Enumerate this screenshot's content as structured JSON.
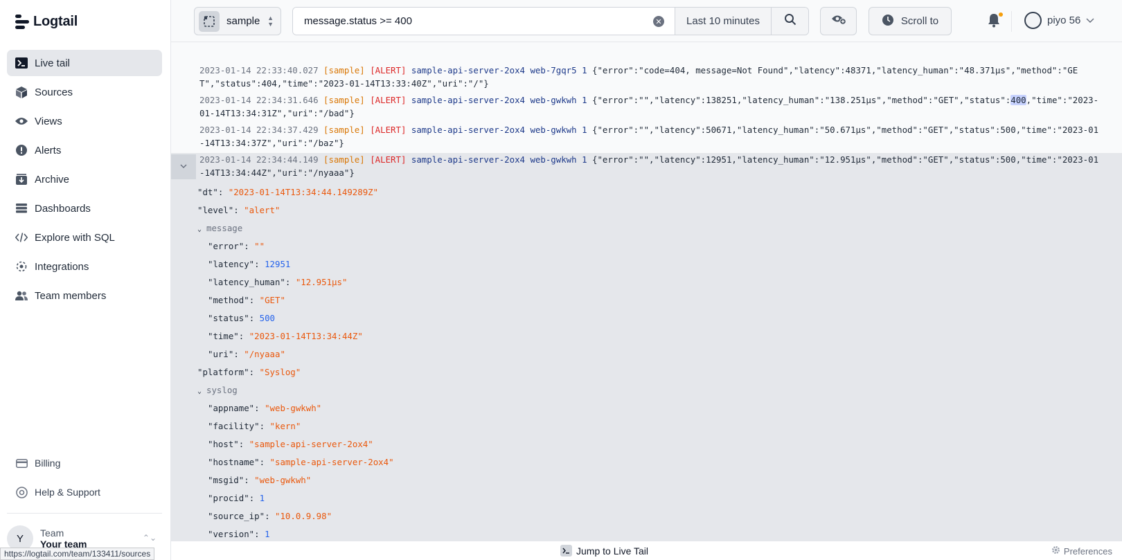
{
  "app": {
    "name": "Logtail"
  },
  "sidebar": {
    "items": [
      {
        "label": "Live tail",
        "icon": "terminal-icon"
      },
      {
        "label": "Sources",
        "icon": "cube-icon"
      },
      {
        "label": "Views",
        "icon": "eye-icon"
      },
      {
        "label": "Alerts",
        "icon": "alert-icon"
      },
      {
        "label": "Archive",
        "icon": "archive-icon"
      },
      {
        "label": "Dashboards",
        "icon": "dashboard-icon"
      },
      {
        "label": "Explore with SQL",
        "icon": "code-icon"
      },
      {
        "label": "Integrations",
        "icon": "integrations-icon"
      },
      {
        "label": "Team members",
        "icon": "users-icon"
      }
    ],
    "bottom": [
      {
        "label": "Billing",
        "icon": "card-icon"
      },
      {
        "label": "Help & Support",
        "icon": "help-icon"
      }
    ],
    "team": {
      "avatar": "Y",
      "label": "Team",
      "name": "Your team"
    },
    "status_url": "https://logtail.com/team/133411/sources"
  },
  "topbar": {
    "source": "sample",
    "query": "message.status >= 400",
    "time_range": "Last 10 minutes",
    "scroll_to": "Scroll to",
    "user": "piyo 56"
  },
  "logs": [
    {
      "ts": "2023-01-14 22:33:40.027",
      "source": "[sample]",
      "level": "[ALERT]",
      "host": "sample-api-server-2ox4 web-7gqr5 1",
      "pre": "{\"error\":\"code=404, message=Not Found\",\"latency\":48371,\"latency_human\":\"48.371µs\",\"method\":\"GET\",\"status\":404,\"time\":\"2023-01-14T13:33:40Z\",\"uri\":\"/\"}",
      "hit": "",
      "post": ""
    },
    {
      "ts": "2023-01-14 22:34:31.646",
      "source": "[sample]",
      "level": "[ALERT]",
      "host": "sample-api-server-2ox4 web-gwkwh 1",
      "pre": "{\"error\":\"\",\"latency\":138251,\"latency_human\":\"138.251µs\",\"method\":\"GET\",\"status\":",
      "hit": "400",
      "post": ",\"time\":\"2023-01-14T13:34:31Z\",\"uri\":\"/bad\"}"
    },
    {
      "ts": "2023-01-14 22:34:37.429",
      "source": "[sample]",
      "level": "[ALERT]",
      "host": "sample-api-server-2ox4 web-gwkwh 1",
      "pre": "{\"error\":\"\",\"latency\":50671,\"latency_human\":\"50.671µs\",\"method\":\"GET\",\"status\":500,\"time\":\"2023-01-14T13:34:37Z\",\"uri\":\"/baz\"}",
      "hit": "",
      "post": ""
    },
    {
      "ts": "2023-01-14 22:34:44.149",
      "source": "[sample]",
      "level": "[ALERT]",
      "host": "sample-api-server-2ox4 web-gwkwh 1",
      "pre": "{\"error\":\"\",\"latency\":12951,\"latency_human\":\"12.951µs\",\"method\":\"GET\",\"status\":500,\"time\":\"2023-01-14T13:34:44Z\",\"uri\":\"/nyaaa\"}",
      "hit": "",
      "post": ""
    }
  ],
  "detail": [
    {
      "key": "\"dt\"",
      "value": "\"2023-01-14T13:34:44.149289Z\"",
      "type": "str",
      "indent": 0
    },
    {
      "key": "\"level\"",
      "value": "\"alert\"",
      "type": "str",
      "indent": 0
    },
    {
      "key": "message",
      "value": "",
      "type": "group",
      "indent": 0
    },
    {
      "key": "\"error\"",
      "value": "\"\"",
      "type": "str",
      "indent": 1
    },
    {
      "key": "\"latency\"",
      "value": "12951",
      "type": "num",
      "indent": 1
    },
    {
      "key": "\"latency_human\"",
      "value": "\"12.951µs\"",
      "type": "str",
      "indent": 1
    },
    {
      "key": "\"method\"",
      "value": "\"GET\"",
      "type": "str",
      "indent": 1
    },
    {
      "key": "\"status\"",
      "value": "500",
      "type": "num",
      "indent": 1
    },
    {
      "key": "\"time\"",
      "value": "\"2023-01-14T13:34:44Z\"",
      "type": "str",
      "indent": 1
    },
    {
      "key": "\"uri\"",
      "value": "\"/nyaaa\"",
      "type": "str",
      "indent": 1
    },
    {
      "key": "\"platform\"",
      "value": "\"Syslog\"",
      "type": "str",
      "indent": 0
    },
    {
      "key": "syslog",
      "value": "",
      "type": "group",
      "indent": 0
    },
    {
      "key": "\"appname\"",
      "value": "\"web-gwkwh\"",
      "type": "str",
      "indent": 1
    },
    {
      "key": "\"facility\"",
      "value": "\"kern\"",
      "type": "str",
      "indent": 1
    },
    {
      "key": "\"host\"",
      "value": "\"sample-api-server-2ox4\"",
      "type": "str",
      "indent": 1
    },
    {
      "key": "\"hostname\"",
      "value": "\"sample-api-server-2ox4\"",
      "type": "str",
      "indent": 1
    },
    {
      "key": "\"msgid\"",
      "value": "\"web-gwkwh\"",
      "type": "str",
      "indent": 1
    },
    {
      "key": "\"procid\"",
      "value": "1",
      "type": "num",
      "indent": 1
    },
    {
      "key": "\"source_ip\"",
      "value": "\"10.0.9.98\"",
      "type": "str",
      "indent": 1
    },
    {
      "key": "\"version\"",
      "value": "1",
      "type": "num",
      "indent": 1
    }
  ],
  "bottombar": {
    "jump": "Jump to Live Tail",
    "preferences": "Preferences"
  },
  "colors": {
    "accent": "#f59e0b",
    "string": "#ea580c",
    "number": "#2563eb",
    "alert": "#dc2626",
    "source": "#d97706",
    "highlight": "#c7d2fe"
  }
}
